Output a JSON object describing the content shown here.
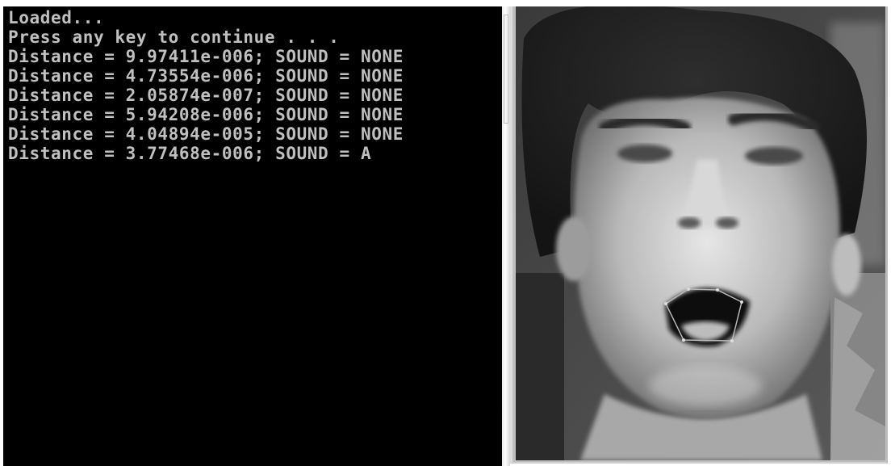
{
  "console": {
    "lines": [
      "Loaded...",
      "Press any key to continue . . .",
      "Distance = 9.97411e-006; SOUND = NONE",
      "Distance = 4.73554e-006; SOUND = NONE",
      "Distance = 2.05874e-007; SOUND = NONE",
      "Distance = 5.94208e-006; SOUND = NONE",
      "Distance = 4.04894e-005; SOUND = NONE",
      "Distance = 3.77468e-006; SOUND = A"
    ],
    "text_color": "#c0c0c0",
    "background": "#000000"
  },
  "camera": {
    "mode": "grayscale",
    "overlay": "mouth-contour"
  }
}
